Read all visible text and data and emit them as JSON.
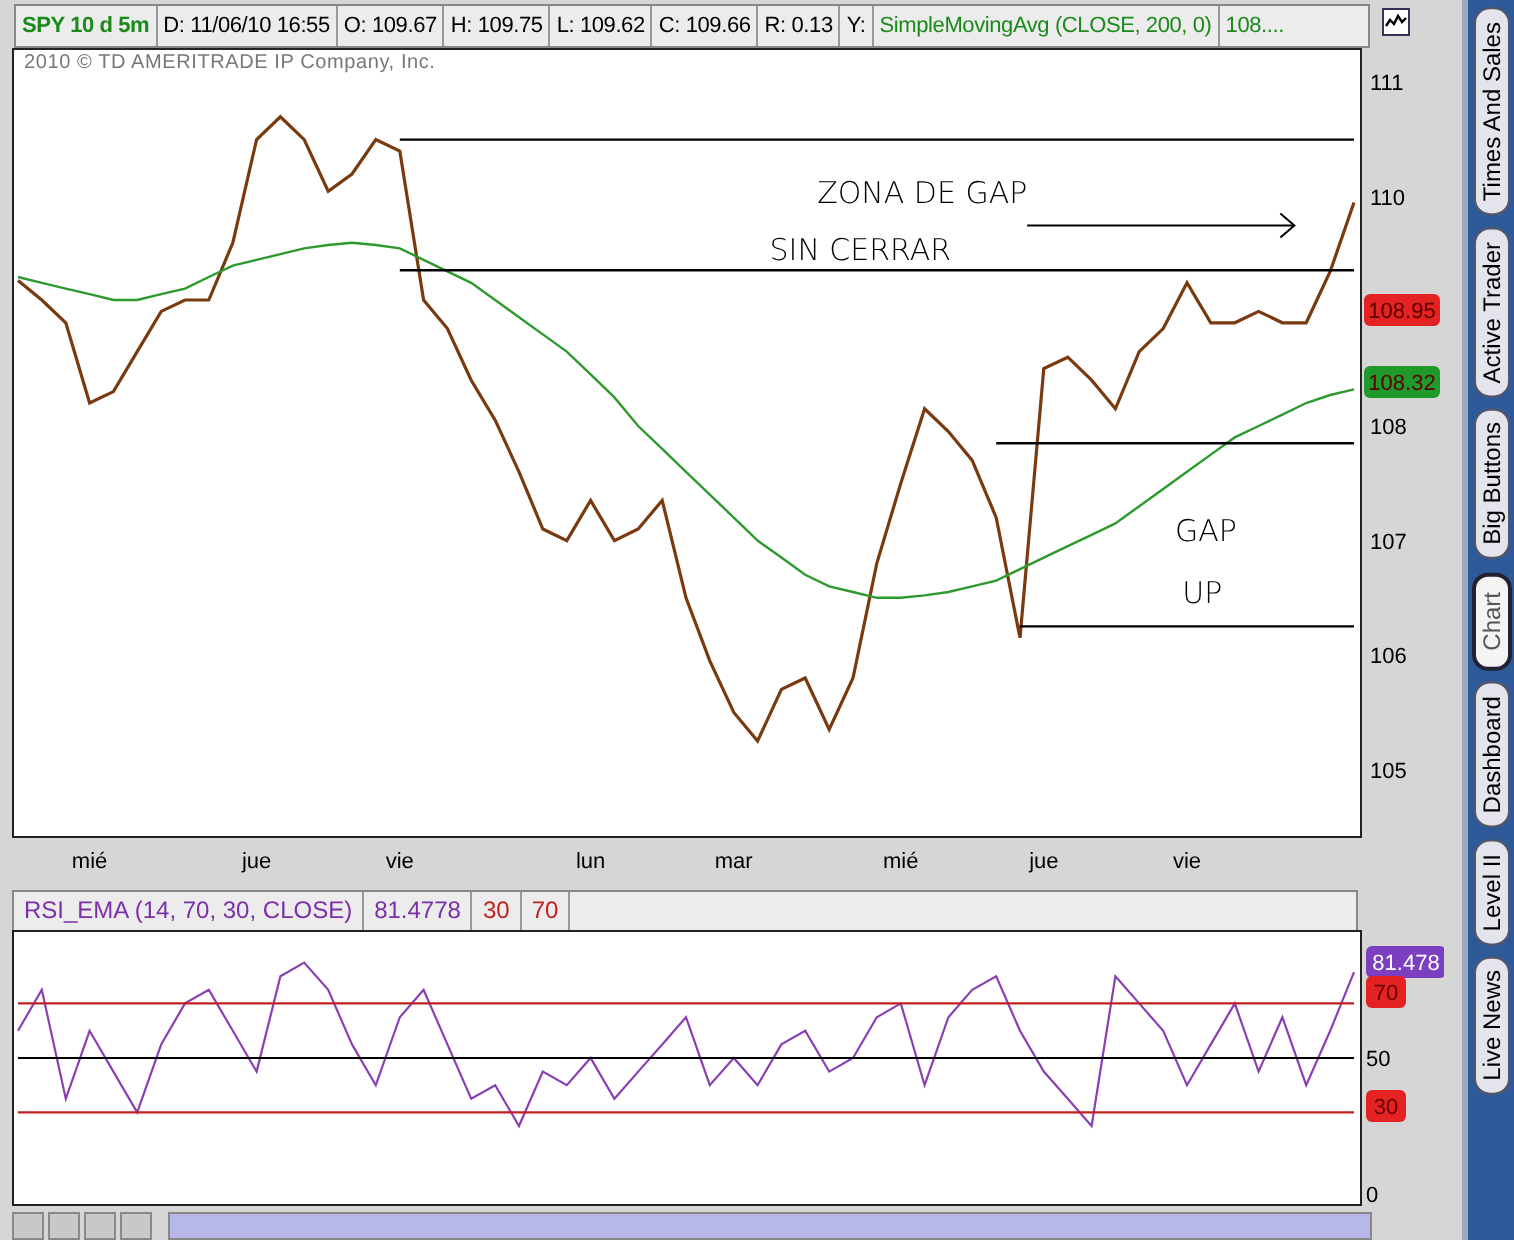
{
  "header": {
    "fields": [
      {
        "text": "SPY 10 d 5m",
        "color": "#1a8a1a",
        "kind": "symbol"
      },
      {
        "text": "D: 11/06/10 16:55",
        "color": "#000000",
        "kind": "field"
      },
      {
        "text": "O: 109.67",
        "color": "#000000",
        "kind": "field"
      },
      {
        "text": "H: 109.75",
        "color": "#000000",
        "kind": "field"
      },
      {
        "text": "L: 109.62",
        "color": "#000000",
        "kind": "field"
      },
      {
        "text": "C: 109.66",
        "color": "#000000",
        "kind": "field"
      },
      {
        "text": "R: 0.13",
        "color": "#000000",
        "kind": "field"
      },
      {
        "text": "Y:",
        "color": "#000000",
        "kind": "field"
      },
      {
        "text": "SimpleMovingAvg (CLOSE, 200, 0)",
        "color": "#1a8a1a",
        "kind": "field"
      },
      {
        "text": "108....",
        "color": "#1a8a1a",
        "kind": "field"
      }
    ]
  },
  "price_panel": {
    "copyright": "2010 © TD AMERITRADE IP Company, Inc.",
    "price_badges": [
      {
        "text": "108.95",
        "color": "#e52222"
      },
      {
        "text": "108.32",
        "color": "#1f9a2a"
      }
    ],
    "chart_data": {
      "type": "line",
      "categories": [
        null,
        null,
        null,
        "mié",
        null,
        null,
        null,
        null,
        null,
        null,
        "jue",
        null,
        null,
        null,
        null,
        null,
        "vie",
        null,
        null,
        null,
        null,
        null,
        null,
        null,
        "lun",
        null,
        null,
        null,
        null,
        null,
        "mar",
        null,
        null,
        null,
        null,
        null,
        null,
        "mié",
        null,
        null,
        null,
        null,
        null,
        "jue",
        null,
        null,
        null,
        null,
        null,
        "vie",
        null,
        null,
        null,
        null,
        null,
        null,
        null
      ],
      "series": [
        {
          "color": "#7a3a10",
          "values": [
            109.27,
            109.1,
            108.9,
            108.2,
            108.3,
            108.65,
            109.0,
            109.1,
            109.1,
            109.6,
            110.5,
            110.7,
            110.5,
            110.05,
            110.2,
            110.5,
            110.4,
            109.1,
            108.85,
            108.4,
            108.05,
            107.6,
            107.1,
            107.0,
            107.35,
            107.0,
            107.1,
            107.35,
            106.5,
            105.95,
            105.5,
            105.25,
            105.7,
            105.8,
            105.35,
            105.8,
            106.8,
            107.5,
            108.15,
            107.95,
            107.7,
            107.2,
            106.15,
            108.5,
            108.6,
            108.4,
            108.15,
            108.65,
            108.85,
            109.25,
            108.9,
            108.9,
            109.0,
            108.9,
            108.9,
            109.35,
            109.95
          ]
        },
        {
          "color": "#2e9a2e",
          "values": [
            109.3,
            109.25,
            109.2,
            109.15,
            109.1,
            109.1,
            109.15,
            109.2,
            109.3,
            109.4,
            109.45,
            109.5,
            109.55,
            109.58,
            109.6,
            109.58,
            109.55,
            109.45,
            109.35,
            109.25,
            109.1,
            108.95,
            108.8,
            108.65,
            108.45,
            108.25,
            108.0,
            107.8,
            107.6,
            107.4,
            107.2,
            107.0,
            106.85,
            106.7,
            106.6,
            106.55,
            106.5,
            106.5,
            106.52,
            106.55,
            106.6,
            106.65,
            106.75,
            106.85,
            106.95,
            107.05,
            107.15,
            107.3,
            107.45,
            107.6,
            107.75,
            107.9,
            108.0,
            108.1,
            108.2,
            108.27,
            108.32
          ]
        },
        {
          "color": "#000000",
          "values": [
            null,
            null,
            null,
            null,
            null,
            null,
            null,
            null,
            null,
            null,
            null,
            null,
            null,
            null,
            null,
            null,
            110.5,
            110.5,
            110.5,
            110.5,
            110.5,
            110.5,
            110.5,
            110.5,
            110.5,
            110.5,
            110.5,
            110.5,
            110.5,
            110.5,
            110.5,
            110.5,
            110.5,
            110.5,
            110.5,
            110.5,
            110.5,
            110.5,
            110.5,
            110.5,
            110.5,
            110.5,
            110.5,
            110.5,
            110.5,
            110.5,
            110.5,
            110.5,
            110.5,
            110.5,
            110.5,
            110.5,
            110.5,
            110.5,
            110.5,
            110.5,
            110.5
          ]
        },
        {
          "color": "#000000",
          "values": [
            null,
            null,
            null,
            null,
            null,
            null,
            null,
            null,
            null,
            null,
            null,
            null,
            null,
            null,
            null,
            null,
            109.36,
            109.36,
            109.36,
            109.36,
            109.36,
            109.36,
            109.36,
            109.36,
            109.36,
            109.36,
            109.36,
            109.36,
            109.36,
            109.36,
            109.36,
            109.36,
            109.36,
            109.36,
            109.36,
            109.36,
            109.36,
            109.36,
            109.36,
            109.36,
            109.36,
            109.36,
            109.36,
            109.36,
            109.36,
            109.36,
            109.36,
            109.36,
            109.36,
            109.36,
            109.36,
            109.36,
            109.36,
            109.36,
            109.36,
            109.36,
            109.36
          ]
        },
        {
          "color": "#000000",
          "values": [
            null,
            null,
            null,
            null,
            null,
            null,
            null,
            null,
            null,
            null,
            null,
            null,
            null,
            null,
            null,
            null,
            null,
            null,
            null,
            null,
            null,
            null,
            null,
            null,
            null,
            null,
            null,
            null,
            null,
            null,
            null,
            null,
            null,
            null,
            null,
            null,
            null,
            null,
            null,
            null,
            null,
            107.85,
            107.85,
            107.85,
            107.85,
            107.85,
            107.85,
            107.85,
            107.85,
            107.85,
            107.85,
            107.85,
            107.85,
            107.85,
            107.85,
            107.85,
            107.85
          ]
        },
        {
          "color": "#000000",
          "values": [
            null,
            null,
            null,
            null,
            null,
            null,
            null,
            null,
            null,
            null,
            null,
            null,
            null,
            null,
            null,
            null,
            null,
            null,
            null,
            null,
            null,
            null,
            null,
            null,
            null,
            null,
            null,
            null,
            null,
            null,
            null,
            null,
            null,
            null,
            null,
            null,
            null,
            null,
            null,
            null,
            null,
            null,
            106.25,
            106.25,
            106.25,
            106.25,
            106.25,
            106.25,
            106.25,
            106.25,
            106.25,
            106.25,
            106.25,
            106.25,
            106.25,
            106.25,
            106.25
          ]
        }
      ],
      "ylim": [
        104.42,
        111.3
      ],
      "yticks": [
        105,
        106,
        107,
        108,
        110,
        111
      ],
      "annotations": [
        "ZONA DE GAP",
        "SIN CERRAR",
        "GAP",
        "UP"
      ]
    }
  },
  "rsi_panel": {
    "header": [
      {
        "text": "RSI_EMA (14, 70, 30, CLOSE)",
        "color": "#7b2fa8"
      },
      {
        "text": "81.4778",
        "color": "#7b2fa8"
      },
      {
        "text": "30",
        "color": "#c02020"
      },
      {
        "text": "70",
        "color": "#c02020"
      }
    ],
    "badges": [
      {
        "text": "81.478",
        "color": "#7b3fc0"
      },
      {
        "text": "70",
        "color": "#e52222"
      },
      {
        "text": "30",
        "color": "#e52222"
      }
    ],
    "chart_data": {
      "type": "line",
      "categories": [
        null,
        null,
        null,
        null,
        null,
        null,
        null,
        null,
        null,
        null,
        null,
        null,
        null,
        null,
        null,
        null,
        null,
        null,
        null,
        null,
        null,
        null,
        null,
        null,
        null,
        null,
        null,
        null,
        null,
        null,
        null,
        null,
        null,
        null,
        null,
        null,
        null,
        null,
        null,
        null,
        null,
        null,
        null,
        null,
        null,
        null,
        null,
        null,
        null,
        null,
        null,
        null,
        null,
        null,
        null,
        null,
        null
      ],
      "series": [
        {
          "color": "#8a3fb5",
          "values": [
            60,
            75,
            35,
            60,
            45,
            30,
            55,
            70,
            75,
            60,
            45,
            80,
            85,
            75,
            55,
            40,
            65,
            75,
            55,
            35,
            40,
            25,
            45,
            40,
            50,
            35,
            45,
            55,
            65,
            40,
            50,
            40,
            55,
            60,
            45,
            50,
            65,
            70,
            40,
            65,
            75,
            80,
            60,
            45,
            35,
            25,
            80,
            70,
            60,
            40,
            55,
            70,
            45,
            65,
            40,
            60,
            81.5
          ]
        },
        {
          "color": "#c02020",
          "values": [
            70,
            70,
            70,
            70,
            70,
            70,
            70,
            70,
            70,
            70,
            70,
            70,
            70,
            70,
            70,
            70,
            70,
            70,
            70,
            70,
            70,
            70,
            70,
            70,
            70,
            70,
            70,
            70,
            70,
            70,
            70,
            70,
            70,
            70,
            70,
            70,
            70,
            70,
            70,
            70,
            70,
            70,
            70,
            70,
            70,
            70,
            70,
            70,
            70,
            70,
            70,
            70,
            70,
            70,
            70,
            70,
            70
          ]
        },
        {
          "color": "#000000",
          "values": [
            50,
            50,
            50,
            50,
            50,
            50,
            50,
            50,
            50,
            50,
            50,
            50,
            50,
            50,
            50,
            50,
            50,
            50,
            50,
            50,
            50,
            50,
            50,
            50,
            50,
            50,
            50,
            50,
            50,
            50,
            50,
            50,
            50,
            50,
            50,
            50,
            50,
            50,
            50,
            50,
            50,
            50,
            50,
            50,
            50,
            50,
            50,
            50,
            50,
            50,
            50,
            50,
            50,
            50,
            50,
            50,
            50
          ]
        },
        {
          "color": "#c02020",
          "values": [
            30,
            30,
            30,
            30,
            30,
            30,
            30,
            30,
            30,
            30,
            30,
            30,
            30,
            30,
            30,
            30,
            30,
            30,
            30,
            30,
            30,
            30,
            30,
            30,
            30,
            30,
            30,
            30,
            30,
            30,
            30,
            30,
            30,
            30,
            30,
            30,
            30,
            30,
            30,
            30,
            30,
            30,
            30,
            30,
            30,
            30,
            30,
            30,
            30,
            30,
            30,
            30,
            30,
            30,
            30,
            30,
            30
          ]
        }
      ],
      "ylim": [
        -4.4,
        97
      ],
      "yticks": [
        0,
        50
      ]
    }
  },
  "side_tabs": [
    {
      "label": "Times And Sales",
      "selected": false
    },
    {
      "label": "Active Trader",
      "selected": false
    },
    {
      "label": "Big Buttons",
      "selected": false
    },
    {
      "label": "Chart",
      "selected": true
    },
    {
      "label": "Dashboard",
      "selected": false
    },
    {
      "label": "Level II",
      "selected": false
    },
    {
      "label": "Live News",
      "selected": false
    }
  ]
}
